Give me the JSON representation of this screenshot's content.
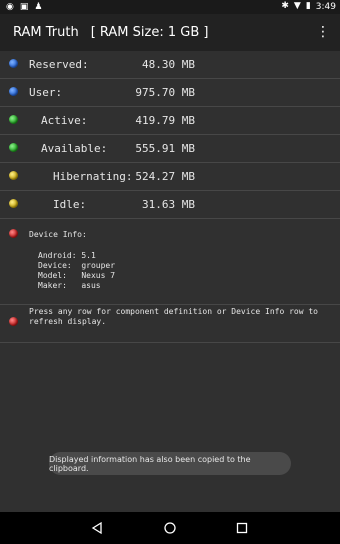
{
  "status": {
    "time": "3:49"
  },
  "appbar": {
    "title": "RAM Truth",
    "ram_size": "[ RAM Size: 1 GB ]"
  },
  "rows": [
    {
      "label": "Reserved:",
      "value": "48.30 MB",
      "color": "blue"
    },
    {
      "label": "User:",
      "value": "975.70 MB",
      "color": "blue"
    },
    {
      "label": "Active:",
      "value": "419.79 MB",
      "color": "green"
    },
    {
      "label": "Available:",
      "value": "555.91 MB",
      "color": "green"
    },
    {
      "label": "Hibernating:",
      "value": "524.27 MB",
      "color": "yellow"
    },
    {
      "label": "Idle:",
      "value": "31.63 MB",
      "color": "yellow"
    }
  ],
  "device": {
    "header": "Device Info:",
    "android": "Android: 5.1",
    "device": "Device:  grouper",
    "model": "Model:   Nexus 7",
    "maker": "Maker:   asus"
  },
  "press_hint": "Press any row for component definition or Device Info row to refresh display.",
  "toast": "Displayed information has also been copied to the clipboard.",
  "colors": {
    "blue": "#1f5fd6",
    "green": "#19a319",
    "yellow": "#c4a200",
    "red": "#c01212"
  }
}
